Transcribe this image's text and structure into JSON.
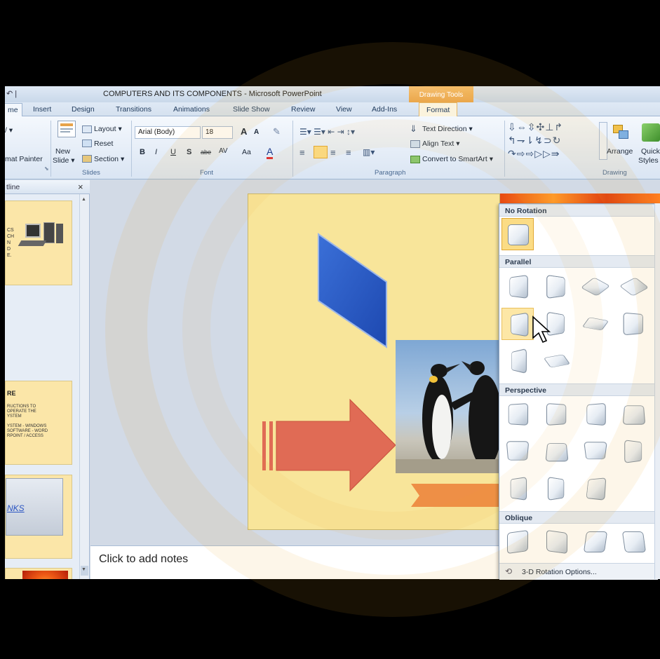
{
  "window": {
    "quick_access": "↶ |",
    "title": "COMPUTERS AND ITS COMPONENTS - Microsoft PowerPoint",
    "contextual_tab": "Drawing Tools"
  },
  "tabs": [
    {
      "label": "me",
      "active": true
    },
    {
      "label": "Insert"
    },
    {
      "label": "Design"
    },
    {
      "label": "Transitions"
    },
    {
      "label": "Animations"
    },
    {
      "label": "Slide Show"
    },
    {
      "label": "Review"
    },
    {
      "label": "View"
    },
    {
      "label": "Add-Ins"
    },
    {
      "label": "Format"
    }
  ],
  "ribbon": {
    "clipboard": {
      "format_painter": "mat Painter",
      "arrow": "/ ▾"
    },
    "slides": {
      "new_slide_line1": "New",
      "new_slide_line2": "Slide ▾",
      "layout": "Layout ▾",
      "reset": "Reset",
      "section": "Section ▾",
      "label": "Slides"
    },
    "font": {
      "name": "Arial (Body)",
      "size": "18",
      "grow": "A",
      "shrink": "A",
      "bold": "B",
      "italic": "I",
      "underline": "U",
      "shadow": "S",
      "strike": "abe",
      "spacing": "AV",
      "case": "Aa",
      "color": "A",
      "label": "Font"
    },
    "paragraph": {
      "text_direction": "Text Direction ▾",
      "align_text": "Align Text ▾",
      "convert_smartart": "Convert to SmartArt ▾",
      "label": "Paragraph"
    },
    "drawing": {
      "arrange": "Arrange",
      "quick_styles_line1": "Quick",
      "quick_styles_line2": "Styles",
      "label": "Drawing"
    }
  },
  "outline_panel": {
    "label": "tline",
    "close": "×",
    "slides": [
      {
        "lines": [
          "CS",
          "CH",
          "N",
          "D",
          "E."
        ]
      },
      {
        "title": "RE",
        "lines": [
          "RUCTIONS TO",
          "OPERATE THE",
          "YSTEM",
          "YSTEM - WINDOWS",
          "SOFTWARE - WORD",
          "RPOINT / ACCESS"
        ]
      },
      {
        "link": "NKS"
      },
      {
        "image": "flower-penguins"
      }
    ]
  },
  "notes_placeholder": "Click to add notes",
  "gallery": {
    "sections": [
      {
        "title": "No Rotation"
      },
      {
        "title": "Parallel"
      },
      {
        "title": "Perspective"
      },
      {
        "title": "Oblique"
      }
    ],
    "footer": "3-D Rotation Options..."
  },
  "colors": {
    "slide_bg": "#f8e59a",
    "arrow": "#e06b55",
    "parallelogram": "#2d5cc4",
    "banner": "#ee8f46",
    "highlight": "#fbdc85"
  }
}
